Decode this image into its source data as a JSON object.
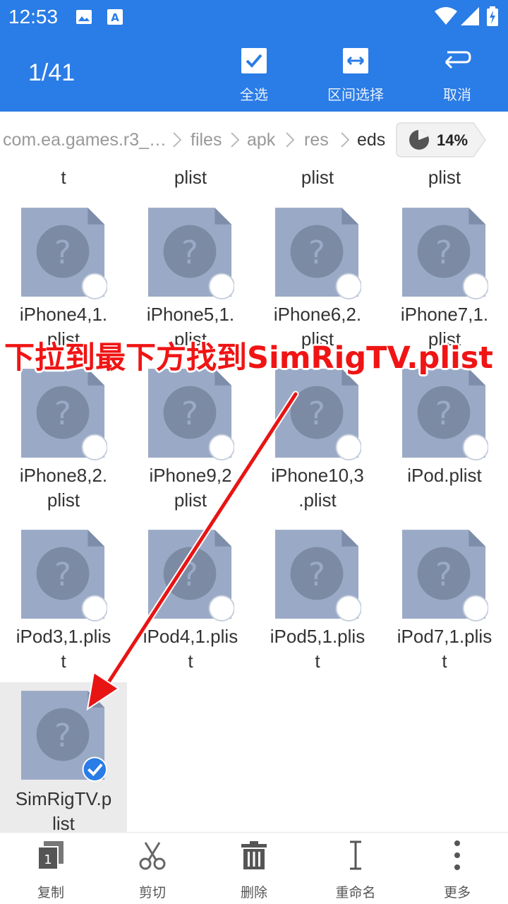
{
  "status_bar": {
    "time": "12:53"
  },
  "action_bar": {
    "counter": "1/41",
    "select_all": "全选",
    "range_select": "区间选择",
    "cancel": "取消"
  },
  "breadcrumb": {
    "items": [
      "com.ea.games.r3_…",
      "files",
      "apk",
      "res",
      "eds"
    ],
    "storage_percent": "14%"
  },
  "files": {
    "row0": [
      "t",
      "plist",
      "plist",
      "plist"
    ],
    "row1": [
      {
        "line1": "iPhone4,1.",
        "line2": "plist"
      },
      {
        "line1": "iPhone5,1.",
        "line2": "plist"
      },
      {
        "line1": "iPhone6,2.",
        "line2": "plist"
      },
      {
        "line1": "iPhone7,1.",
        "line2": "plist"
      }
    ],
    "row2": [
      {
        "line1": "iPhone8,2.",
        "line2": "plist"
      },
      {
        "line1": "iPhone9,2",
        "line2": "plist"
      },
      {
        "line1": "iPhone10,3",
        "line2": ".plist"
      },
      {
        "line1": "iPod.plist",
        "line2": ""
      }
    ],
    "row3": [
      {
        "line1": "iPod3,1.plis",
        "line2": "t"
      },
      {
        "line1": "iPod4,1.plis",
        "line2": "t"
      },
      {
        "line1": "iPod5,1.plis",
        "line2": "t"
      },
      {
        "line1": "iPod7,1.plis",
        "line2": "t"
      }
    ],
    "row4": [
      {
        "line1": "SimRigTV.p",
        "line2": "list"
      }
    ]
  },
  "overlay": {
    "instruction": "下拉到最下方找到SimRigTV.plist"
  },
  "bottom_bar": {
    "copy": "复制",
    "cut": "剪切",
    "delete": "删除",
    "rename": "重命名",
    "more": "更多"
  },
  "colors": {
    "accent": "#2a7ce6",
    "file_icon": "#9aaac6",
    "annotation": "#f01414"
  }
}
